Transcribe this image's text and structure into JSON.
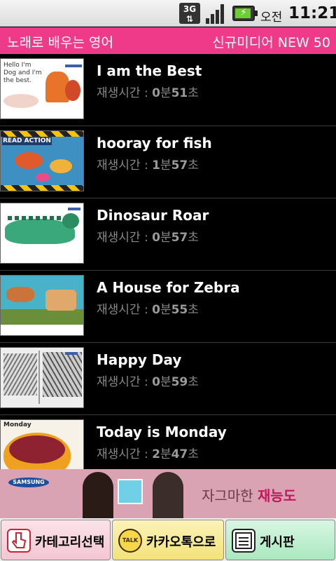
{
  "status_bar": {
    "network": "3G",
    "ampm": "오전",
    "time": "11:21"
  },
  "header": {
    "title": "노래로 배우는 영어",
    "subtitle": "신규미디어 NEW 50"
  },
  "items": [
    {
      "title": "I am the Best",
      "label": "재생시간 : ",
      "min": "0",
      "min_unit": "분",
      "sec": "51",
      "sec_unit": "초"
    },
    {
      "title": "hooray for fish",
      "label": "재생시간 : ",
      "min": "1",
      "min_unit": "분",
      "sec": "57",
      "sec_unit": "초"
    },
    {
      "title": "Dinosaur Roar",
      "label": "재생시간 : ",
      "min": "0",
      "min_unit": "분",
      "sec": "57",
      "sec_unit": "초"
    },
    {
      "title": "A House for Zebra",
      "label": "재생시간 : ",
      "min": "0",
      "min_unit": "분",
      "sec": "55",
      "sec_unit": "초"
    },
    {
      "title": "Happy Day",
      "label": "재생시간 : ",
      "min": "0",
      "min_unit": "분",
      "sec": "59",
      "sec_unit": "초"
    },
    {
      "title": "Today is Monday",
      "label": "재생시간 : ",
      "min": "2",
      "min_unit": "분",
      "sec": "47",
      "sec_unit": "초"
    }
  ],
  "thumb_text": {
    "book1": "Hello I'm Dog and I'm the best.",
    "book2": "READ ACTION",
    "book6": "Monday"
  },
  "ad": {
    "brand": "SAMSUNG",
    "copy_prefix": "자그마한 ",
    "copy_highlight": "재능도"
  },
  "bottom_bar": {
    "category_label": "카테고리선택",
    "kakao_label": "카카오톡으로",
    "kakao_icon_text": "TALK",
    "board_label": "게시판"
  },
  "colors": {
    "accent": "#ee3a89",
    "kakao": "#f7d74a",
    "background": "#000000"
  }
}
